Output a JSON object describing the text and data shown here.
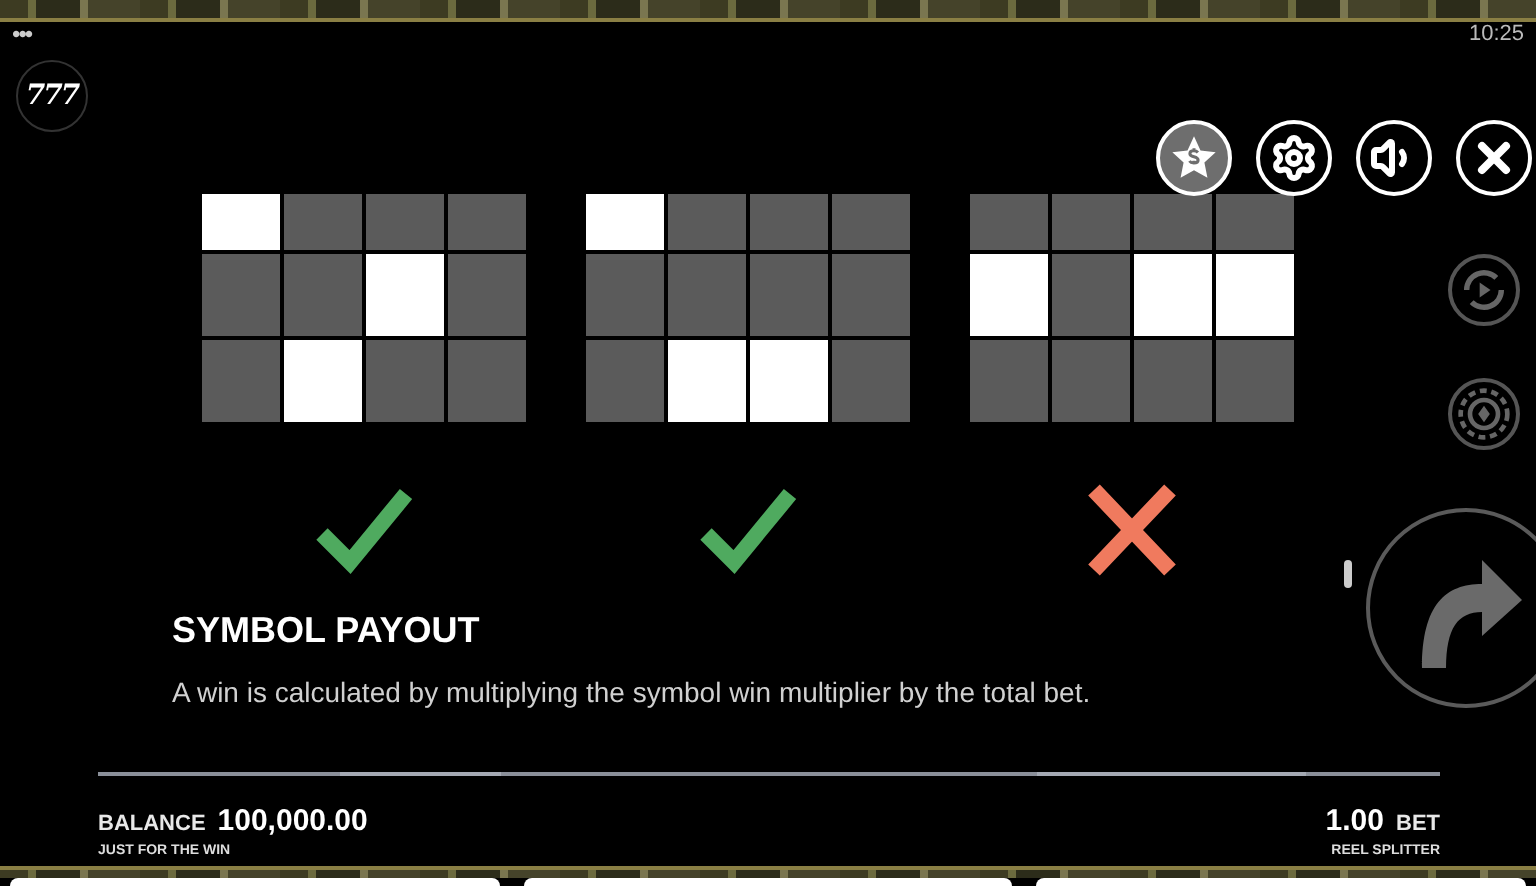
{
  "status_bar": {
    "menu": "•••",
    "time": "10:25"
  },
  "logo": "777",
  "top_buttons": [
    {
      "kind": "bonus"
    },
    {
      "kind": "settings"
    },
    {
      "kind": "sound"
    },
    {
      "kind": "close"
    }
  ],
  "side_buttons": [
    {
      "kind": "autoplay"
    },
    {
      "kind": "bet"
    },
    {
      "kind": "spin"
    }
  ],
  "examples": [
    {
      "winning": true,
      "rows": [
        [
          {
            "lit": true
          },
          {
            "lit": false
          },
          {
            "lit": false
          },
          {
            "lit": false
          }
        ],
        [
          {
            "lit": false
          },
          {
            "lit": false
          },
          {
            "lit": true
          },
          {
            "lit": false
          }
        ],
        [
          {
            "lit": false
          },
          {
            "lit": true
          },
          {
            "lit": false
          },
          {
            "lit": false
          }
        ]
      ]
    },
    {
      "winning": true,
      "rows": [
        [
          {
            "lit": true
          },
          {
            "lit": false
          },
          {
            "lit": false
          },
          {
            "lit": false
          }
        ],
        [
          {
            "lit": false
          },
          {
            "lit": false
          },
          {
            "lit": false
          },
          {
            "lit": false
          }
        ],
        [
          {
            "lit": false
          },
          {
            "lit": true
          },
          {
            "lit": true
          },
          {
            "lit": false
          }
        ]
      ]
    },
    {
      "winning": false,
      "rows": [
        [
          {
            "lit": false
          },
          {
            "lit": false
          },
          {
            "lit": false
          },
          {
            "lit": false
          }
        ],
        [
          {
            "lit": true
          },
          {
            "lit": false
          },
          {
            "lit": true
          },
          {
            "lit": true
          }
        ],
        [
          {
            "lit": false
          },
          {
            "lit": false
          },
          {
            "lit": false
          },
          {
            "lit": false
          }
        ]
      ]
    }
  ],
  "section": {
    "title": "SYMBOL PAYOUT",
    "description": "A win is calculated by multiplying the symbol win multiplier by the total bet."
  },
  "footer": {
    "balance_label": "BALANCE",
    "balance": "100,000.00",
    "left_caption": "JUST FOR THE WIN",
    "bet": "1.00",
    "bet_label": "BET",
    "right_caption": "REEL SPLITTER"
  }
}
